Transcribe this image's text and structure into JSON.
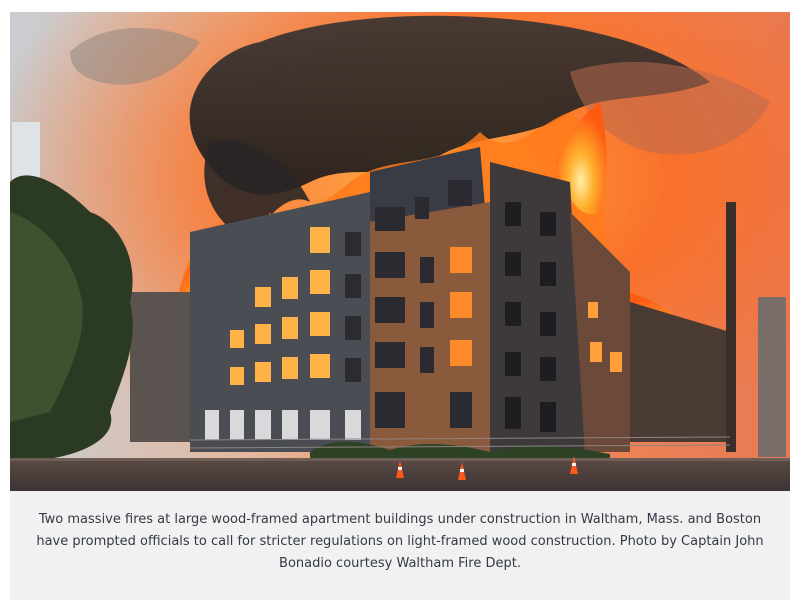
{
  "figure": {
    "image_alt": "Apartment building under construction engulfed in flames with heavy black smoke",
    "caption": "Two massive fires at large wood-framed apartment buildings under construction in Waltham, Mass. and Boston have prompted officials to call for stricter regulations on light-framed wood construction. Photo by Captain John Bonadio courtesy Waltham Fire Dept."
  },
  "colors": {
    "caption_background": "#f1f1f2",
    "caption_text": "#333a44",
    "fire": "#ff7a1a",
    "smoke": "#2a2626"
  }
}
